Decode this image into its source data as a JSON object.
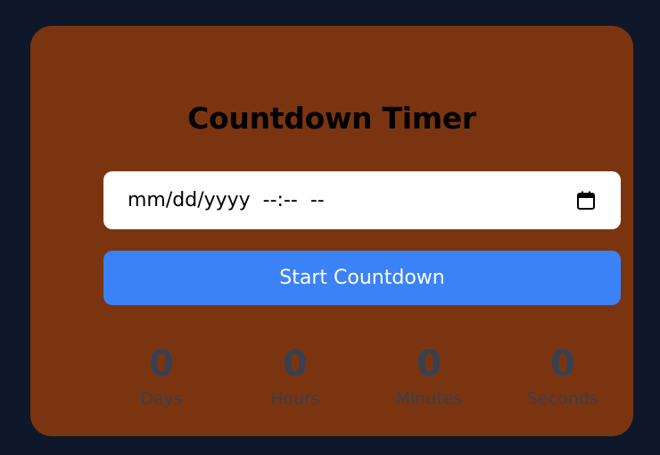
{
  "timer": {
    "title": "Countdown Timer",
    "date_input": {
      "placeholder": "mm/dd/yyyy  --:--  --",
      "icon": "calendar-icon"
    },
    "start_button_label": "Start Countdown",
    "units": [
      {
        "value": "0",
        "label": "Days"
      },
      {
        "value": "0",
        "label": "Hours"
      },
      {
        "value": "0",
        "label": "Minutes"
      },
      {
        "value": "0",
        "label": "Seconds"
      }
    ]
  },
  "colors": {
    "background": "#0f172a",
    "card": "#7a3510",
    "button": "#3b82f6",
    "input": "#ffffff",
    "counter_text": "#374151"
  }
}
